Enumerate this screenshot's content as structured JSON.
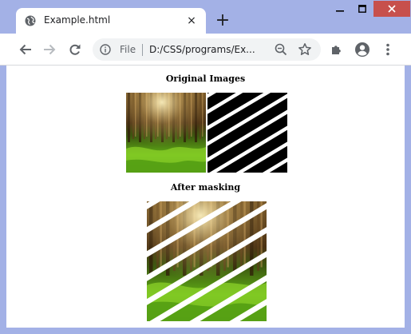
{
  "tab": {
    "title": "Example.html",
    "favicon": "globe-icon",
    "close": "×"
  },
  "new_tab_label": "+",
  "window_controls": [
    "minimize-icon",
    "maximize-icon",
    "close-icon"
  ],
  "toolbar": {
    "back": "back-arrow-icon",
    "forward": "forward-arrow-icon",
    "reload": "reload-icon",
    "extensions": "puzzle-icon",
    "profile": "profile-icon",
    "menu": "kebab-menu-icon"
  },
  "omnibox": {
    "scheme_label": "File",
    "url": "D:/CSS/programs/Ex..."
  },
  "page": {
    "heading_original": "Original Images",
    "heading_after": "After masking"
  },
  "colors": {
    "frame": "#a3b1e6",
    "close_button": "#c7504c",
    "omnibox": "#f1f3f4",
    "forest_dark": "#5a3a16",
    "forest_green": "#5fae16"
  }
}
